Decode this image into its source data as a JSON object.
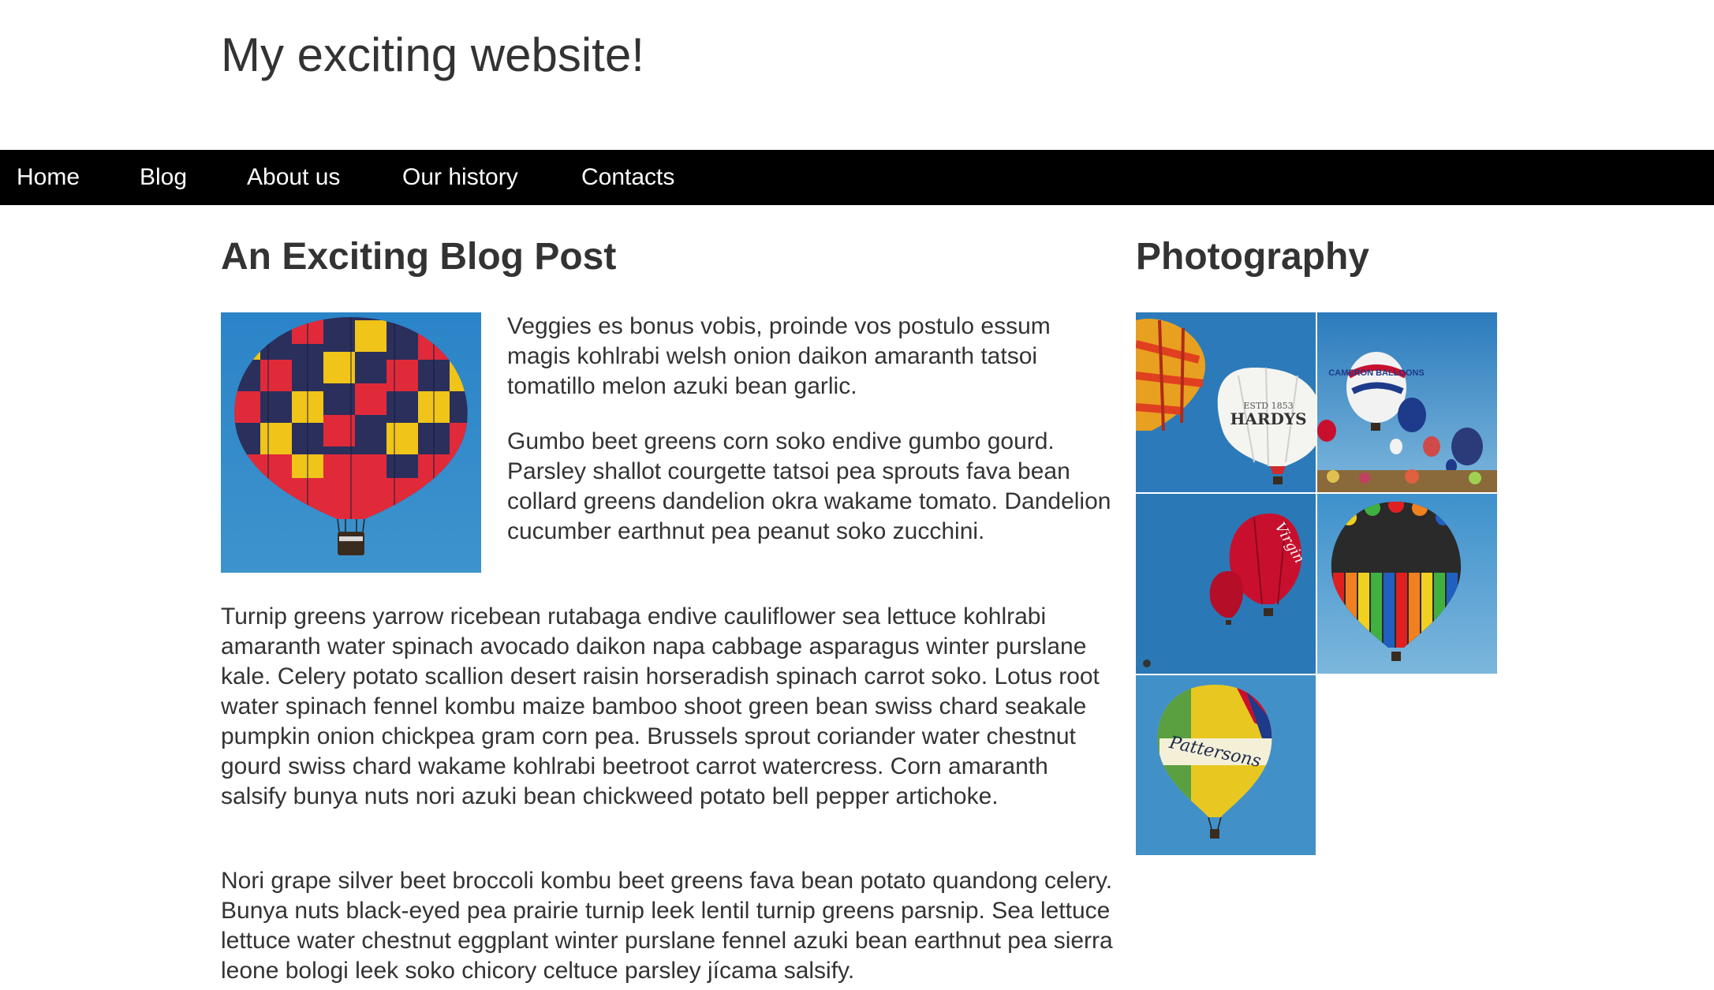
{
  "header": {
    "site_title": "My exciting website!"
  },
  "nav": {
    "items": [
      {
        "label": "Home"
      },
      {
        "label": "Blog"
      },
      {
        "label": "About us"
      },
      {
        "label": "Our history"
      },
      {
        "label": "Contacts"
      }
    ]
  },
  "post": {
    "title": "An Exciting Blog Post",
    "image_icon": "hot-air-balloon-photo",
    "paragraphs": [
      "Veggies es bonus vobis, proinde vos postulo essum magis kohlrabi welsh onion daikon amaranth tatsoi tomatillo melon azuki bean garlic.",
      "Gumbo beet greens corn soko endive gumbo gourd. Parsley shallot courgette tatsoi pea sprouts fava bean collard greens dandelion okra wakame tomato. Dandelion cucumber earthnut pea peanut soko zucchini.",
      "Turnip greens yarrow ricebean rutabaga endive cauliflower sea lettuce kohlrabi amaranth water spinach avocado daikon napa cabbage asparagus winter purslane kale. Celery potato scallion desert raisin horseradish spinach carrot soko. Lotus root water spinach fennel kombu maize bamboo shoot green bean swiss chard seakale pumpkin onion chickpea gram corn pea. Brussels sprout coriander water chestnut gourd swiss chard wakame kohlrabi beetroot carrot watercress. Corn amaranth salsify bunya nuts nori azuki bean chickweed potato bell pepper artichoke.",
      "Nori grape silver beet broccoli kombu beet greens fava bean potato quandong celery. Bunya nuts black-eyed pea prairie turnip leek lentil turnip greens parsnip. Sea lettuce lettuce water chestnut eggplant winter purslane fennel azuki bean earthnut pea sierra leone bologi leek soko chicory celtuce parsley jícama salsify."
    ]
  },
  "sidebar": {
    "title": "Photography",
    "photos": [
      {
        "icon": "balloon-hardys-photo",
        "caption": "HARDYS",
        "subcaption": "ESTD 1853"
      },
      {
        "icon": "balloon-festival-photo",
        "caption": "CAMERON BALLOONS"
      },
      {
        "icon": "balloon-virgin-photo",
        "caption": "Virgin"
      },
      {
        "icon": "balloon-rainbow-photo"
      },
      {
        "icon": "balloon-pattersons-photo",
        "caption": "Pattersons"
      }
    ]
  },
  "colors": {
    "nav_background": "#000000",
    "nav_text": "#ffffff",
    "text": "#333333",
    "sky_blue": "#2f86c4"
  }
}
